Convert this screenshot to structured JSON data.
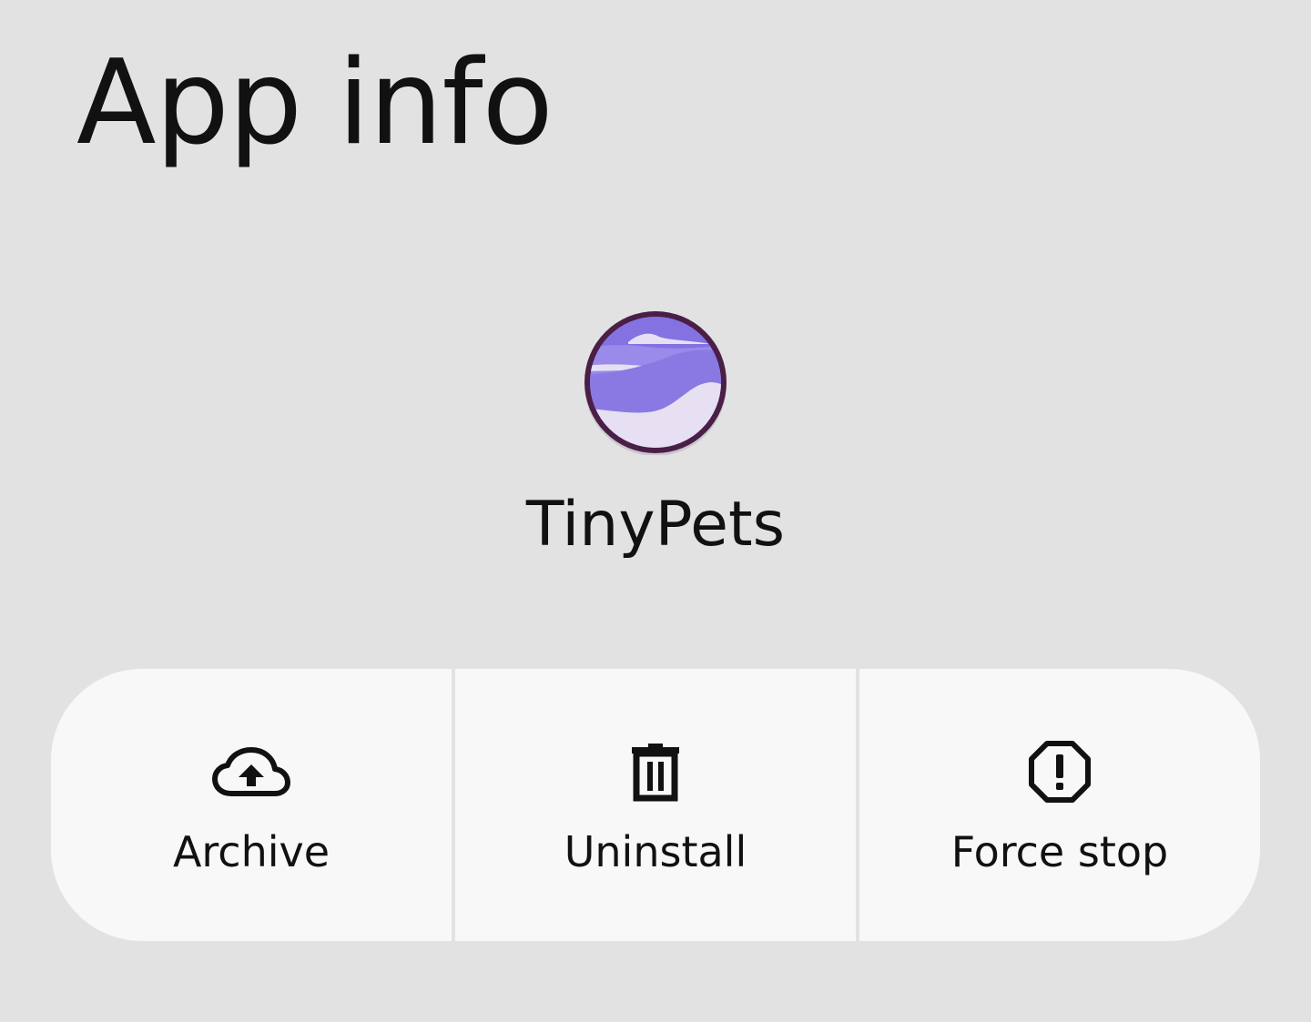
{
  "header": {
    "title": "App info"
  },
  "app": {
    "name": "TinyPets",
    "icon": "tinypets-app-icon",
    "icon_colors": {
      "ring": "#4a1f47",
      "sky": "#8e7de8",
      "cloud": "#e6e0f2"
    }
  },
  "actions": [
    {
      "label": "Archive",
      "icon": "cloud-upload-icon"
    },
    {
      "label": "Uninstall",
      "icon": "trash-icon"
    },
    {
      "label": "Force stop",
      "icon": "warning-octagon-icon"
    }
  ],
  "colors": {
    "background": "#e2e2e2",
    "button_background": "#f8f8f8",
    "text": "#111111"
  }
}
